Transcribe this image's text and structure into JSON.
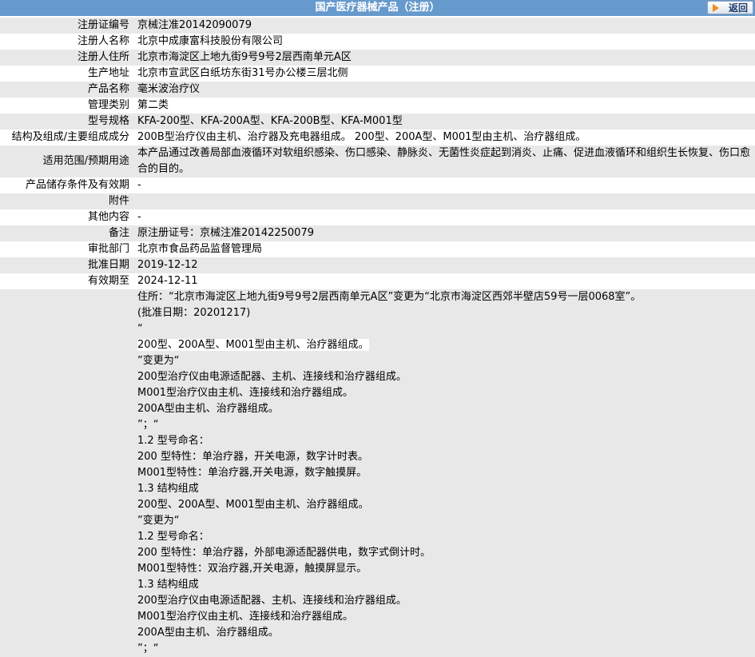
{
  "header": {
    "title": "国产医疗器械产品（注册）",
    "back_label": "返回"
  },
  "rows": [
    {
      "label": "注册证编号",
      "value": "京械注准20142090079"
    },
    {
      "label": "注册人名称",
      "value": "北京中成康富科技股份有限公司"
    },
    {
      "label": "注册人住所",
      "value": "北京市海淀区上地九街9号9号2层西南单元A区"
    },
    {
      "label": "生产地址",
      "value": "北京市宣武区白纸坊东街31号办公楼三层北侧"
    },
    {
      "label": "产品名称",
      "value": "毫米波治疗仪"
    },
    {
      "label": "管理类别",
      "value": "第二类"
    },
    {
      "label": "型号规格",
      "value": "KFA-200型、KFA-200A型、KFA-200B型、KFA-M001型"
    },
    {
      "label": "结构及组成/主要组成成分",
      "value": "200B型治疗仪由主机、治疗器及充电器组成。 200型、200A型、M001型由主机、治疗器组成。"
    },
    {
      "label": "适用范围/预期用途",
      "value": "本产品通过改善局部血液循环对软组织感染、伤口感染、静脉炎、无菌性炎症起到消炎、止痛、促进血液循环和组织生长恢复、伤口愈合的目的。"
    },
    {
      "label": "产品储存条件及有效期",
      "value": "-"
    },
    {
      "label": "附件",
      "value": ""
    },
    {
      "label": "其他内容",
      "value": "-"
    },
    {
      "label": "备注",
      "value": "原注册证号：京械注准20142250079"
    },
    {
      "label": "审批部门",
      "value": "北京市食品药品监督管理局"
    },
    {
      "label": "批准日期",
      "value": "2019-12-12"
    },
    {
      "label": "有效期至",
      "value": "2024-12-11"
    }
  ],
  "changes": [
    "住所：“北京市海淀区上地九街9号9号2层西南单元A区”变更为“北京市海淀区西郊半壁店59号一层0068室”。",
    "(批准日期：20201217)",
    " “",
    "200型、200A型、M001型由主机、治疗器组成。",
    "”变更为“",
    "200型治疗仪由电源适配器、主机、连接线和治疗器组成。",
    "M001型治疗仪由主机、连接线和治疗器组成。",
    "200A型由主机、治疗器组成。",
    "”；“",
    "1.2 型号命名：",
    "200 型特性：单治疗器，开关电源，数字计时表。",
    "M001型特性：单治疗器,开关电源，数字触摸屏。",
    "1.3 结构组成",
    "200型、200A型、M001型由主机、治疗器组成。",
    "”变更为“",
    "1.2 型号命名：",
    "200 型特性：单治疗器，外部电源适配器供电，数字式倒计时。",
    "M001型特性：双治疗器,开关电源，触摸屏显示。",
    "1.3 结构组成",
    "200型治疗仪由电源适配器、主机、连接线和治疗器组成。",
    "M001型治疗仪由主机、连接线和治疗器组成。",
    "200A型由主机、治疗器组成。",
    "”；“"
  ]
}
